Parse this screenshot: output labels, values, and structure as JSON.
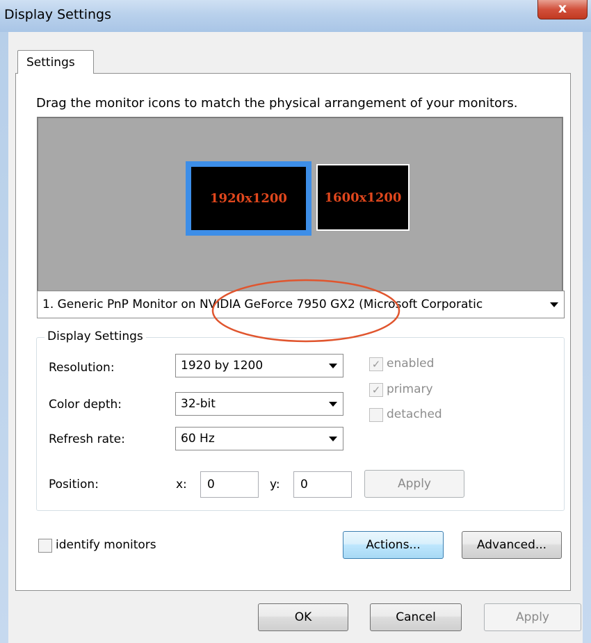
{
  "window": {
    "title": "Display Settings",
    "close_glyph": "x"
  },
  "tabs": [
    {
      "label": "Settings",
      "active": true
    }
  ],
  "instructions": "Drag the monitor icons to match the physical arrangement of your monitors.",
  "monitors": [
    {
      "label": "1920x1200",
      "selected": true
    },
    {
      "label": "1600x1200",
      "selected": false
    }
  ],
  "monitor_select": {
    "value": "1. Generic PnP Monitor on NVIDIA GeForce 7950 GX2 (Microsoft Corporatic"
  },
  "display_settings": {
    "group_title": "Display Settings",
    "resolution": {
      "label": "Resolution:",
      "value": "1920 by 1200"
    },
    "color_depth": {
      "label": "Color depth:",
      "value": "32-bit"
    },
    "refresh_rate": {
      "label": "Refresh rate:",
      "value": "60 Hz"
    },
    "checkboxes": [
      {
        "label": "enabled",
        "checked": true,
        "disabled": true
      },
      {
        "label": "primary",
        "checked": true,
        "disabled": true
      },
      {
        "label": "detached",
        "checked": false,
        "disabled": true
      }
    ],
    "position": {
      "label": "Position:",
      "x_label": "x:",
      "x_value": "0",
      "y_label": "y:",
      "y_value": "0",
      "apply_label": "Apply"
    }
  },
  "identify_monitors": {
    "label": "identify monitors",
    "checked": false
  },
  "buttons": {
    "actions": "Actions...",
    "advanced": "Advanced...",
    "ok": "OK",
    "cancel": "Cancel",
    "apply": "Apply"
  },
  "colors": {
    "monitor_label": "#e0471d",
    "selected_monitor_border": "#3d8ee8",
    "annotation": "#e0552e"
  },
  "icons": {
    "close": "close-icon",
    "dropdown": "chevron-down-icon",
    "checkbox": "checkmark-icon"
  }
}
